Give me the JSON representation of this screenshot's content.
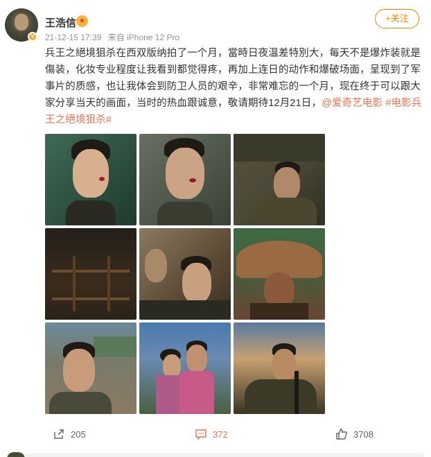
{
  "post": {
    "author": "王浩信",
    "timestamp": "21-12-15 17:39",
    "source": "来自 iPhone 12 Pro",
    "follow_label": "+关注",
    "verified_badge": "V",
    "rank_icon": "rank-medal-icon",
    "text": {
      "body": "兵王之絕境狙杀在西双版纳拍了一个月，當時日夜温差特別大，每天不是爆炸装就是傷装，化妆专业程度让我看到都觉得疼，再加上连日的动作和爆破场面，呈现到了军事片的质感，也让我体会到防卫人员的艰辛，非常难忘的一个月，现在终于可以跟大家分享当天的画面，当时的热血跟诚意，敬请期待12月21日，",
      "mention": "@爱奇艺电影",
      "hashtag": "#电影兵王之絕境狙杀#"
    },
    "images": [
      {
        "alt": "photo-1"
      },
      {
        "alt": "photo-2"
      },
      {
        "alt": "photo-3"
      },
      {
        "alt": "photo-4"
      },
      {
        "alt": "photo-5"
      },
      {
        "alt": "photo-6"
      },
      {
        "alt": "photo-7"
      },
      {
        "alt": "photo-8"
      },
      {
        "alt": "photo-9"
      }
    ],
    "actions": {
      "shares": "205",
      "comments": "372",
      "likes": "3708"
    }
  },
  "colors": {
    "accent": "#ff8200",
    "link": "#eb7350",
    "meta_text": "#939393"
  }
}
